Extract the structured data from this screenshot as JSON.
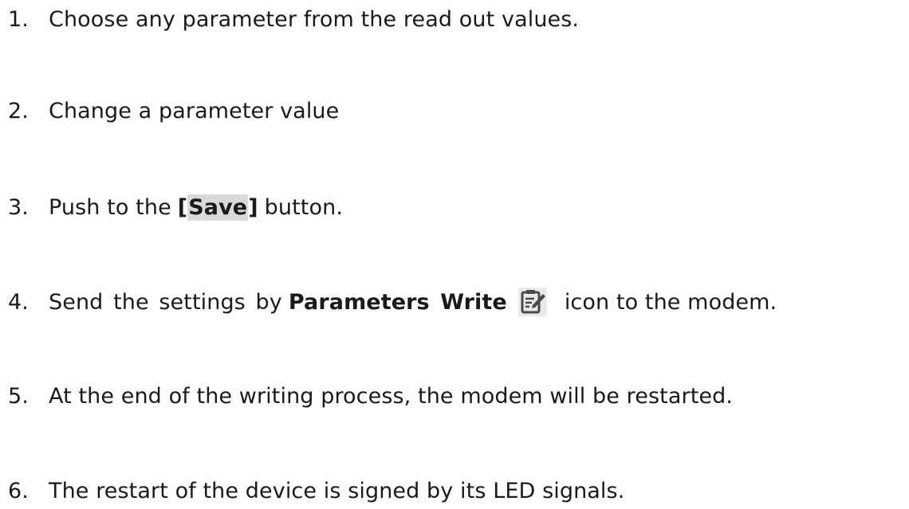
{
  "steps": [
    {
      "number": "1.",
      "text": "Choose any parameter from the read out values."
    },
    {
      "number": "2.",
      "text": "Change a parameter value"
    },
    {
      "number": "3.",
      "prefix": "Push to the",
      "bold": "[Save]",
      "suffix": "button."
    },
    {
      "number": "4.",
      "prefix": "Send the settings by",
      "bold": "Parameters Write",
      "icon": "parameters-write-icon",
      "suffix": "icon to the modem."
    },
    {
      "number": "5.",
      "text": "At the end of the writing process, the modem will be restarted."
    },
    {
      "number": "6.",
      "text": "The restart of the device is signed by its LED signals."
    }
  ]
}
